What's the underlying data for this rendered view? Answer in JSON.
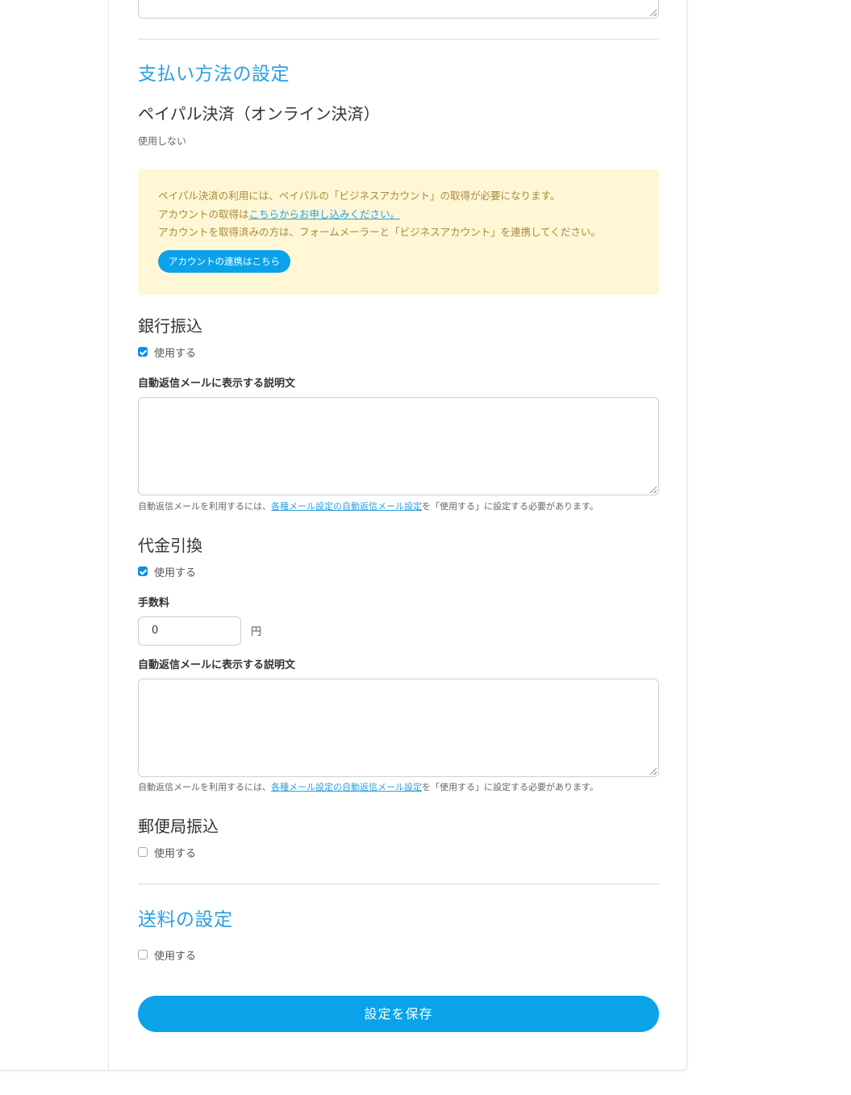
{
  "payment_section": {
    "title": "支払い方法の設定",
    "paypal": {
      "title": "ペイパル決済（オンライン決済）",
      "status": "使用しない",
      "notice_line1": "ペイパル決済の利用には、ペイパルの「ビジネスアカウント」の取得が必要になります。",
      "notice_line2_prefix": "アカウントの取得は",
      "notice_line2_link": "こちらからお申し込みください。",
      "notice_line3": "アカウントを取得済みの方は、フォームメーラーと「ビジネスアカウント」を連携してください。",
      "connect_button": "アカウントの連携はこちら"
    },
    "bank_transfer": {
      "title": "銀行振込",
      "use_label": "使用する",
      "use_checked": true,
      "description_label": "自動返信メールに表示する説明文",
      "description_value": "",
      "help_prefix": "自動返信メールを利用するには、",
      "help_link": "各種メール設定の自動返信メール設定",
      "help_suffix": "を「使用する」に設定する必要があります。"
    },
    "cod": {
      "title": "代金引換",
      "use_label": "使用する",
      "use_checked": true,
      "fee_label": "手数料",
      "fee_value": "0",
      "fee_unit": "円",
      "description_label": "自動返信メールに表示する説明文",
      "description_value": "",
      "help_prefix": "自動返信メールを利用するには、",
      "help_link": "各種メール設定の自動返信メール設定",
      "help_suffix": "を「使用する」に設定する必要があります。"
    },
    "postal_transfer": {
      "title": "郵便局振込",
      "use_label": "使用する",
      "use_checked": false
    }
  },
  "shipping_section": {
    "title": "送料の設定",
    "use_label": "使用する",
    "use_checked": false
  },
  "save_button": "設定を保存",
  "colors": {
    "accent": "#0aa3ea",
    "heading": "#2aa0e0",
    "notice_bg": "#fff7d6",
    "notice_text": "#a88a3a"
  }
}
